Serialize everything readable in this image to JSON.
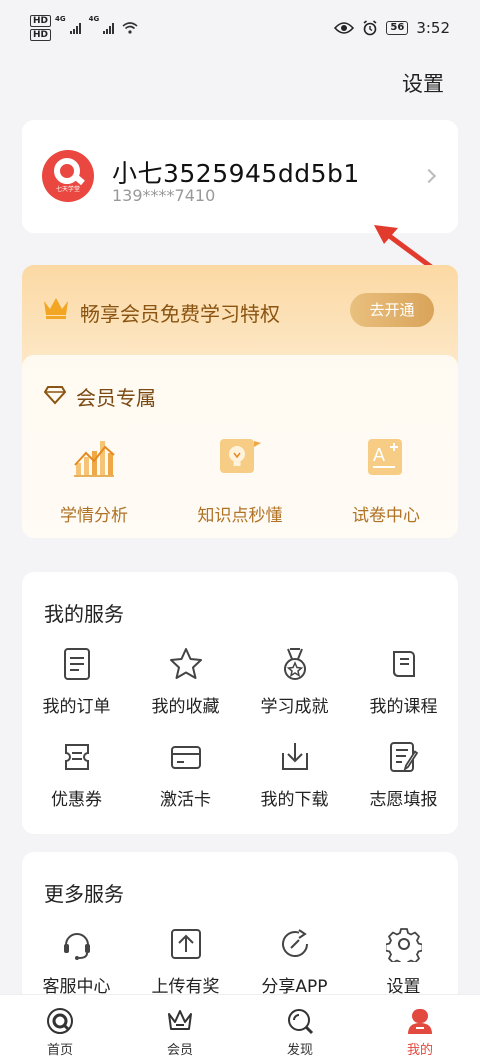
{
  "status_bar": {
    "time": "3:52",
    "battery": "56",
    "network_a": "4G",
    "network_b": "4G",
    "hd": "HD"
  },
  "header": {
    "settings_label": "设置"
  },
  "profile": {
    "name": "小七3525945dd5b1",
    "phone": "139****7410",
    "avatar_text": "七天学堂"
  },
  "vip": {
    "banner_text": "畅享会员免费学习特权",
    "open_button": "去开通",
    "section_title": "会员专属",
    "perks": [
      {
        "label": "学情分析",
        "icon": "chart-icon"
      },
      {
        "label": "知识点秒懂",
        "icon": "lightbulb-icon"
      },
      {
        "label": "试卷中心",
        "icon": "exam-paper-icon"
      }
    ]
  },
  "my_services": {
    "title": "我的服务",
    "items": [
      {
        "label": "我的订单",
        "icon": "order-icon"
      },
      {
        "label": "我的收藏",
        "icon": "star-icon"
      },
      {
        "label": "学习成就",
        "icon": "medal-icon"
      },
      {
        "label": "我的课程",
        "icon": "course-book-icon"
      },
      {
        "label": "优惠券",
        "icon": "coupon-icon"
      },
      {
        "label": "激活卡",
        "icon": "card-icon"
      },
      {
        "label": "我的下载",
        "icon": "download-icon"
      },
      {
        "label": "志愿填报",
        "icon": "application-form-icon"
      }
    ]
  },
  "more_services": {
    "title": "更多服务",
    "items": [
      {
        "label": "客服中心",
        "icon": "headset-icon"
      },
      {
        "label": "上传有奖",
        "icon": "upload-icon"
      },
      {
        "label": "分享APP",
        "icon": "share-icon"
      },
      {
        "label": "设置",
        "icon": "gear-icon"
      }
    ]
  },
  "tabbar": {
    "active_color": "#e24a3f",
    "tabs": [
      {
        "label": "首页",
        "icon": "home-icon"
      },
      {
        "label": "会员",
        "icon": "crown-icon"
      },
      {
        "label": "发现",
        "icon": "discover-icon"
      },
      {
        "label": "我的",
        "icon": "profile-icon",
        "active": true
      }
    ]
  }
}
